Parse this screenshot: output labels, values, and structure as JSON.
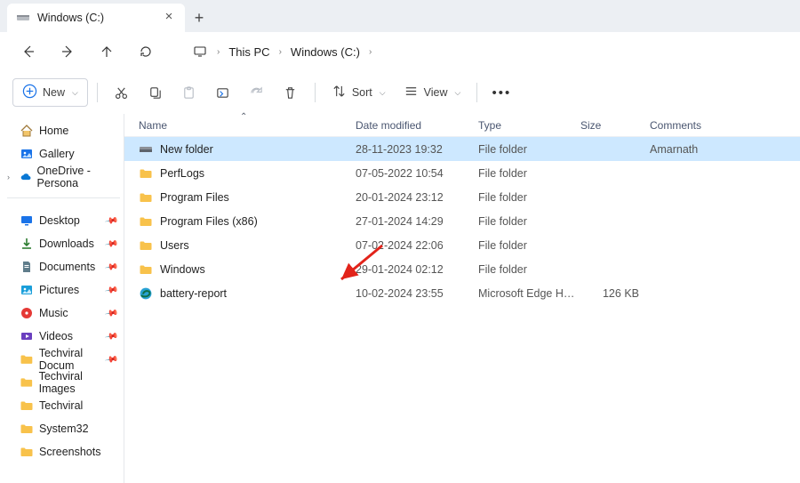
{
  "tab": {
    "title": "Windows (C:)"
  },
  "breadcrumbs": [
    "This PC",
    "Windows (C:)"
  ],
  "toolbar": {
    "new": "New",
    "sort": "Sort",
    "view": "View"
  },
  "sidebar": {
    "top": [
      {
        "label": "Home"
      },
      {
        "label": "Gallery"
      },
      {
        "label": "OneDrive - Persona",
        "expandable": true
      }
    ],
    "pinned": [
      {
        "label": "Desktop"
      },
      {
        "label": "Downloads"
      },
      {
        "label": "Documents"
      },
      {
        "label": "Pictures"
      },
      {
        "label": "Music"
      },
      {
        "label": "Videos"
      },
      {
        "label": "Techviral Docum"
      },
      {
        "label": "Techviral Images"
      },
      {
        "label": "Techviral"
      },
      {
        "label": "System32"
      },
      {
        "label": "Screenshots"
      }
    ]
  },
  "columns": {
    "name": "Name",
    "date": "Date modified",
    "type": "Type",
    "size": "Size",
    "comments": "Comments"
  },
  "rows": [
    {
      "name": "New folder",
      "date": "28-11-2023 19:32",
      "type": "File folder",
      "size": "",
      "comments": "Amarnath",
      "icon": "drive",
      "selected": true
    },
    {
      "name": "PerfLogs",
      "date": "07-05-2022 10:54",
      "type": "File folder",
      "size": "",
      "comments": "",
      "icon": "folder"
    },
    {
      "name": "Program Files",
      "date": "20-01-2024 23:12",
      "type": "File folder",
      "size": "",
      "comments": "",
      "icon": "folder"
    },
    {
      "name": "Program Files (x86)",
      "date": "27-01-2024 14:29",
      "type": "File folder",
      "size": "",
      "comments": "",
      "icon": "folder"
    },
    {
      "name": "Users",
      "date": "07-02-2024 22:06",
      "type": "File folder",
      "size": "",
      "comments": "",
      "icon": "folder"
    },
    {
      "name": "Windows",
      "date": "29-01-2024 02:12",
      "type": "File folder",
      "size": "",
      "comments": "",
      "icon": "folder"
    },
    {
      "name": "battery-report",
      "date": "10-02-2024 23:55",
      "type": "Microsoft Edge HTM...",
      "size": "126 KB",
      "comments": "",
      "icon": "edge"
    }
  ]
}
